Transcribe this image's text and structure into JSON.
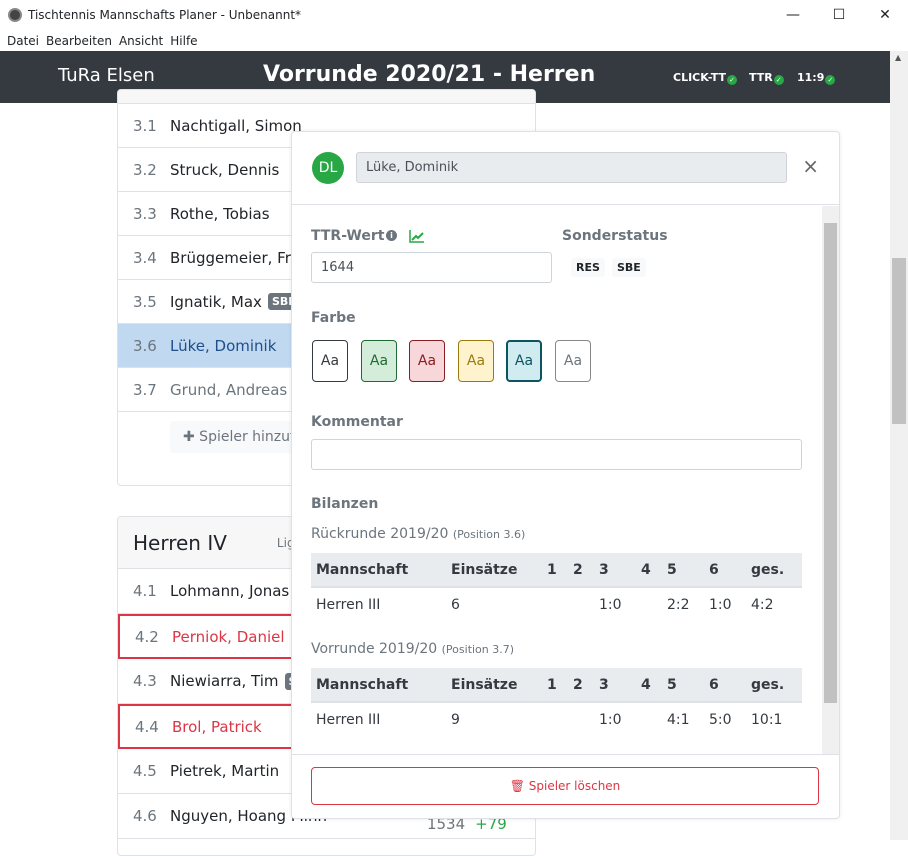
{
  "window": {
    "title": "Tischtennis Mannschafts Planer - Unbenannt*",
    "minimize": "—",
    "maximize": "☐",
    "close": "✕"
  },
  "menu": [
    "Datei",
    "Bearbeiten",
    "Ansicht",
    "Hilfe"
  ],
  "header": {
    "club": "TuRa Elsen",
    "title": "Vorrunde 2020/21 - Herren",
    "status": [
      {
        "label": "CLICK-TT"
      },
      {
        "label": "TTR"
      },
      {
        "label": "11:9"
      }
    ],
    "check": "✓"
  },
  "team3": {
    "players": [
      {
        "pos": "3.1",
        "name": "Nachtigall, Simon"
      },
      {
        "pos": "3.2",
        "name": "Struck, Dennis"
      },
      {
        "pos": "3.3",
        "name": "Rothe, Tobias"
      },
      {
        "pos": "3.4",
        "name": "Brüggemeier, Frank"
      },
      {
        "pos": "3.5",
        "name": "Ignatik, Max",
        "badge": "SBE"
      },
      {
        "pos": "3.6",
        "name": "Lüke, Dominik"
      },
      {
        "pos": "3.7",
        "name": "Grund, Andreas"
      }
    ],
    "add_label": "✚ Spieler hinzufügen"
  },
  "team4": {
    "name": "Herren IV",
    "league": "Liga",
    "players": [
      {
        "pos": "4.1",
        "name": "Lohmann, Jonas"
      },
      {
        "pos": "4.2",
        "name": "Perniok, Daniel"
      },
      {
        "pos": "4.3",
        "name": "Niewiarra, Tim",
        "badge": "SBE"
      },
      {
        "pos": "4.4",
        "name": "Brol, Patrick"
      },
      {
        "pos": "4.5",
        "name": "Pietrek, Martin"
      },
      {
        "pos": "4.6",
        "name": "Nguyen, Hoang Minh",
        "ttr": "1534",
        "diff": "+79"
      }
    ]
  },
  "modal": {
    "initials": "DL",
    "name": "Lüke, Dominik",
    "close": "×",
    "ttr_label": "TTR-Wert",
    "ttr_value": "1644",
    "sonder_label": "Sonderstatus",
    "sonder": [
      "RES",
      "SBE"
    ],
    "farbe_label": "Farbe",
    "swatch_text": "Aa",
    "kommentar_label": "Kommentar",
    "kommentar_value": "",
    "bilanzen_label": "Bilanzen",
    "columns": [
      "Mannschaft",
      "Einsätze",
      "1",
      "2",
      "3",
      "4",
      "5",
      "6",
      "ges."
    ],
    "seasons": [
      {
        "title": "Rückrunde 2019/20",
        "position": "(Position 3.6)",
        "row": [
          "Herren III",
          "6",
          "",
          "",
          "1:0",
          "",
          "2:2",
          "1:0",
          "4:2"
        ]
      },
      {
        "title": "Vorrunde 2019/20",
        "position": "(Position 3.7)",
        "row": [
          "Herren III",
          "9",
          "",
          "",
          "1:0",
          "",
          "4:1",
          "5:0",
          "10:1"
        ]
      }
    ],
    "delete_label": "🗑 Spieler löschen"
  },
  "colors": {
    "header": "#343a40",
    "accent": "#28a745",
    "danger": "#dc3545"
  }
}
